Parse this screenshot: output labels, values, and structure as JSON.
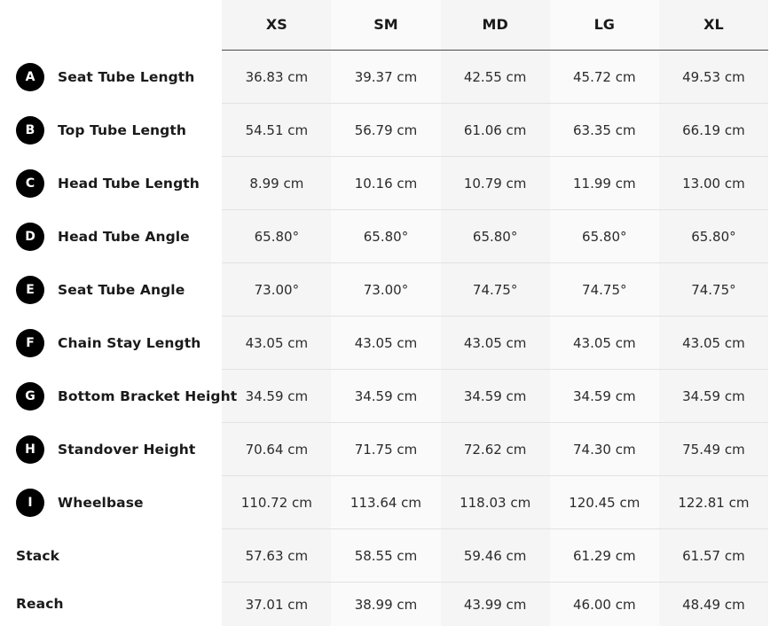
{
  "sizes": [
    "XS",
    "SM",
    "MD",
    "LG",
    "XL"
  ],
  "rows": [
    {
      "letter": "A",
      "label": "Seat Tube Length",
      "values": [
        "36.83 cm",
        "39.37 cm",
        "42.55 cm",
        "45.72 cm",
        "49.53 cm"
      ]
    },
    {
      "letter": "B",
      "label": "Top Tube Length",
      "values": [
        "54.51 cm",
        "56.79 cm",
        "61.06 cm",
        "63.35 cm",
        "66.19 cm"
      ]
    },
    {
      "letter": "C",
      "label": "Head Tube Length",
      "values": [
        "8.99 cm",
        "10.16 cm",
        "10.79 cm",
        "11.99 cm",
        "13.00 cm"
      ]
    },
    {
      "letter": "D",
      "label": "Head Tube Angle",
      "values": [
        "65.80°",
        "65.80°",
        "65.80°",
        "65.80°",
        "65.80°"
      ]
    },
    {
      "letter": "E",
      "label": "Seat Tube Angle",
      "values": [
        "73.00°",
        "73.00°",
        "74.75°",
        "74.75°",
        "74.75°"
      ]
    },
    {
      "letter": "F",
      "label": "Chain Stay Length",
      "values": [
        "43.05 cm",
        "43.05 cm",
        "43.05 cm",
        "43.05 cm",
        "43.05 cm"
      ]
    },
    {
      "letter": "G",
      "label": "Bottom Bracket Height",
      "values": [
        "34.59 cm",
        "34.59 cm",
        "34.59 cm",
        "34.59 cm",
        "34.59 cm"
      ]
    },
    {
      "letter": "H",
      "label": "Standover Height",
      "values": [
        "70.64 cm",
        "71.75 cm",
        "72.62 cm",
        "74.30 cm",
        "75.49 cm"
      ]
    },
    {
      "letter": "I",
      "label": "Wheelbase",
      "values": [
        "110.72 cm",
        "113.64 cm",
        "118.03 cm",
        "120.45 cm",
        "122.81 cm"
      ]
    },
    {
      "letter": "",
      "label": "Stack",
      "values": [
        "57.63 cm",
        "58.55 cm",
        "59.46 cm",
        "61.29 cm",
        "61.57 cm"
      ]
    },
    {
      "letter": "",
      "label": "Reach",
      "values": [
        "37.01 cm",
        "38.99 cm",
        "43.99 cm",
        "46.00 cm",
        "48.49 cm"
      ]
    }
  ],
  "colors": {
    "badge": "#000000",
    "column_shade_a": "#f5f5f5",
    "column_shade_b": "#fafafa",
    "header_rule": "#4a4a4a",
    "row_rule": "#e2e2e2"
  }
}
